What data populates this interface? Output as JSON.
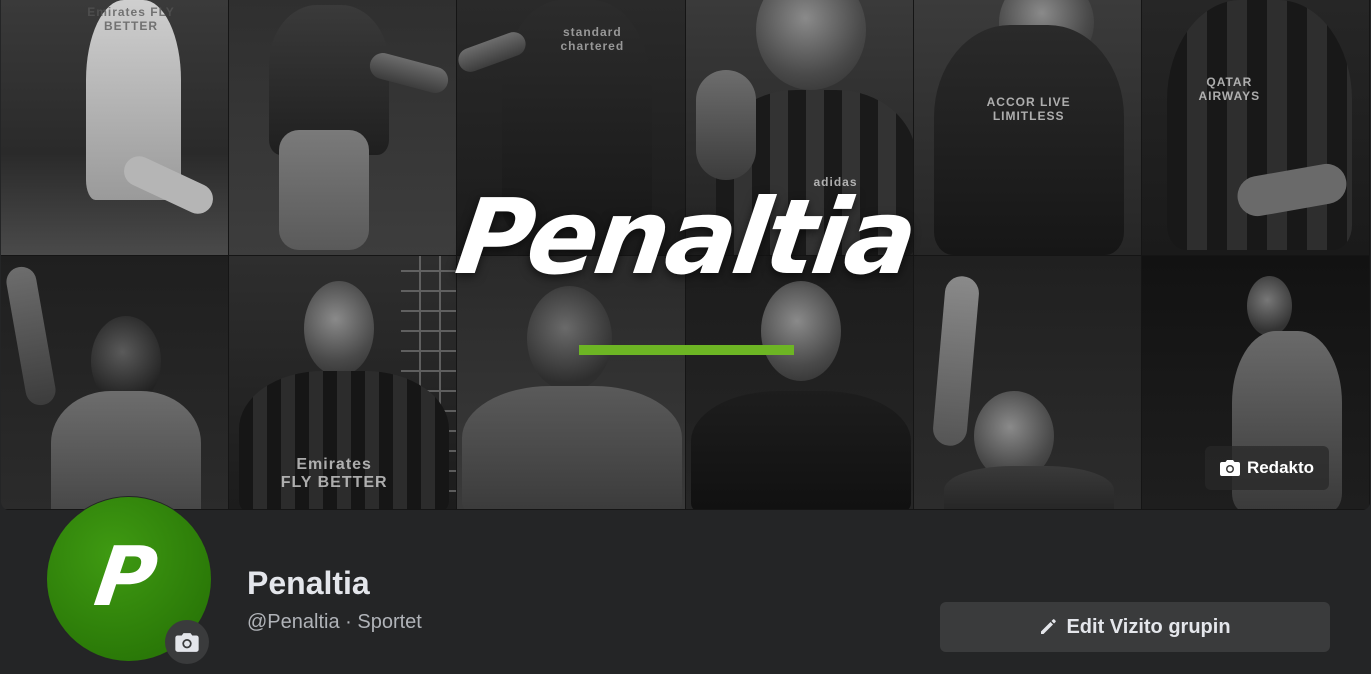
{
  "cover": {
    "logo_text": "Penaltia",
    "edit_label": "Redakto",
    "accent_color": "#6db524",
    "jersey_texts": [
      "Emirates FLY BETTER",
      "standard chartered",
      "adidas",
      "ACCOR LIVE LIMITLESS",
      "QATAR AIRWAYS",
      "Emirates FLY BETTER"
    ]
  },
  "profile": {
    "avatar_letter": "P",
    "name": "Penaltia",
    "subtitle": "@Penaltia · Sportet",
    "edit_button_label": "Edit Vizito grupin"
  },
  "icons": {
    "cover_edit": "camera-icon",
    "avatar_edit": "camera-icon",
    "edit_button": "pencil-icon"
  }
}
